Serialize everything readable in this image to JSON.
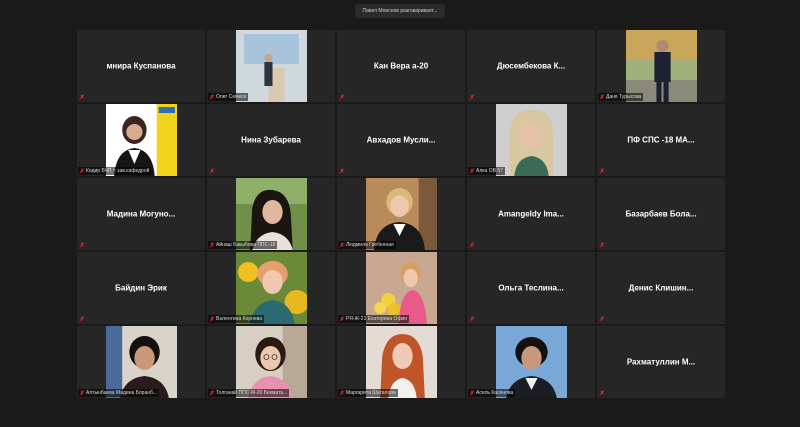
{
  "speaker_banner": "Павел Моисеев разговаривает...",
  "tiles": [
    {
      "name": "мнира Куспанова",
      "caption": ""
    },
    {
      "name": "",
      "caption": "Олег Семеск"
    },
    {
      "name": "Кан Вера а-20",
      "caption": ""
    },
    {
      "name": "Дюсембекова К...",
      "caption": ""
    },
    {
      "name": "",
      "caption": "Даня Турысова"
    },
    {
      "name": "",
      "caption": "Кодир БЧП ~ зав.кафедрой"
    },
    {
      "name": "Нина Зубарева",
      "caption": ""
    },
    {
      "name": "Авхадов Мусли...",
      "caption": ""
    },
    {
      "name": "",
      "caption": "Алка ОВ 57"
    },
    {
      "name": "ПФ СПС -18 МА...",
      "caption": ""
    },
    {
      "name": "Мадина Могуно...",
      "caption": ""
    },
    {
      "name": "",
      "caption": "Айнаш Бакыбова ППС-19"
    },
    {
      "name": "",
      "caption": "Людмила Гребенная"
    },
    {
      "name": "Amangeldy Ima...",
      "caption": ""
    },
    {
      "name": "Базарбаев Бола...",
      "caption": ""
    },
    {
      "name": "Байдин Эрик",
      "caption": ""
    },
    {
      "name": "",
      "caption": "Валентина Корнева"
    },
    {
      "name": "",
      "caption": "РЯ-Ж-21 Екатерина Офин"
    },
    {
      "name": "Ольга Теслина...",
      "caption": ""
    },
    {
      "name": "Денис Клишин...",
      "caption": ""
    },
    {
      "name": "",
      "caption": "Алтынбаева Мадина Боранб..."
    },
    {
      "name": "",
      "caption": "Толганай ППС-М-20 Бекмата..."
    },
    {
      "name": "",
      "caption": "Маргарита Шаталова"
    },
    {
      "name": "",
      "caption": "Асель Касенова"
    },
    {
      "name": "Рахматуллин М...",
      "caption": ""
    }
  ],
  "colors": {
    "background": "#1a1a1a",
    "tile": "#262626",
    "muted_mic": "#e02828",
    "name_text": "#ffffff"
  },
  "icons": {
    "muted_mic": "microphone-muted-icon"
  }
}
